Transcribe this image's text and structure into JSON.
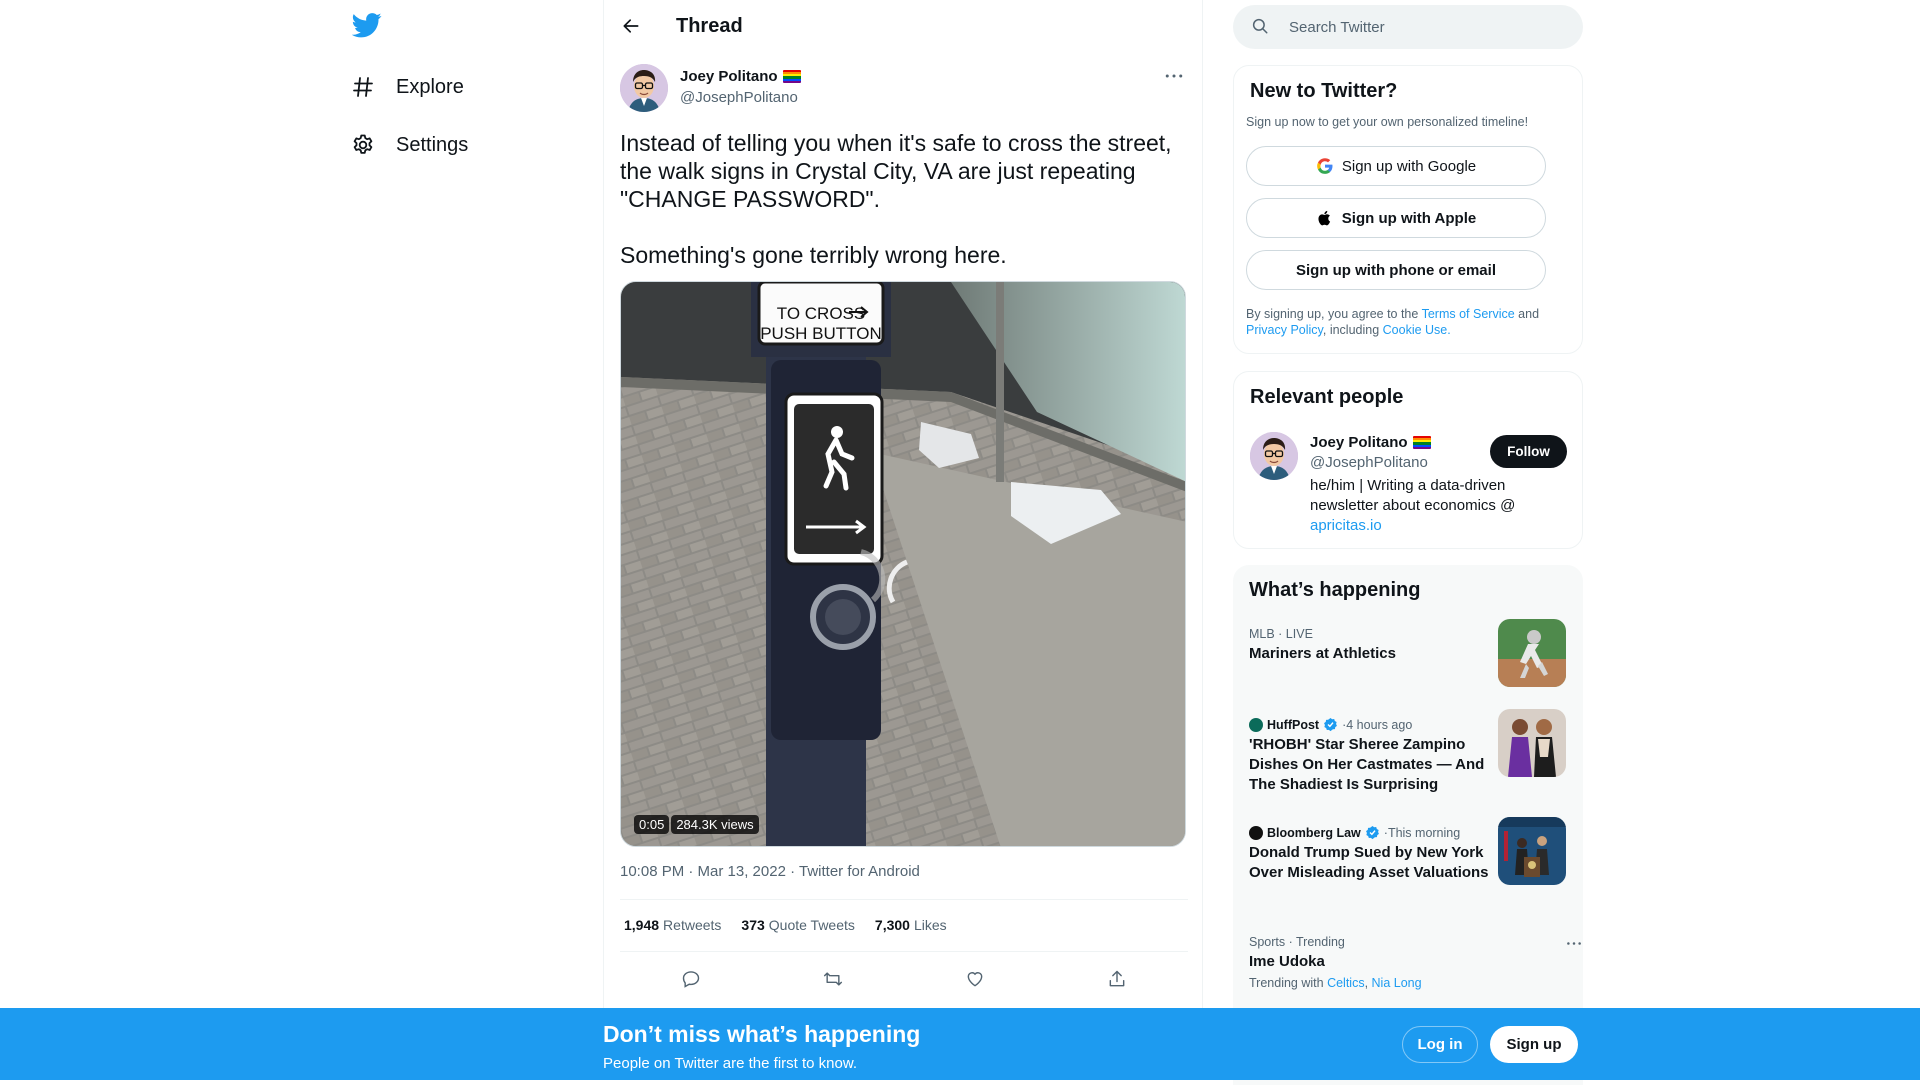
{
  "colors": {
    "brand": "#1d9bf0",
    "text": "#0f1419",
    "muted": "#536471"
  },
  "nav": {
    "items": [
      {
        "icon": "hashtag-icon",
        "label": "Explore"
      },
      {
        "icon": "gear-icon",
        "label": "Settings"
      }
    ]
  },
  "thread": {
    "title": "Thread",
    "author": {
      "name": "Joey Politano",
      "handle": "@JosephPolitano"
    },
    "text": "Instead of telling you when it's safe to cross the street, the walk signs in Crystal City, VA are just repeating \"CHANGE PASSWORD\".\n\nSomething's gone terribly wrong here.",
    "media": {
      "sign_text": "TO CROSS\nPUSH BUTTON",
      "duration": "0:05",
      "views": "284.3K views"
    },
    "meta": "10:08 PM · Mar 13, 2022 · Twitter for Android",
    "stats": [
      {
        "value": "1,948",
        "label": "Retweets"
      },
      {
        "value": "373",
        "label": "Quote Tweets"
      },
      {
        "value": "7,300",
        "label": "Likes"
      }
    ]
  },
  "search": {
    "placeholder": "Search Twitter"
  },
  "new_to_twitter": {
    "title": "New to Twitter?",
    "subtitle": "Sign up now to get your own personalized timeline!",
    "google": "Sign up with Google",
    "apple": "Sign up with Apple",
    "phone": "Sign up with phone or email",
    "legal_pre": "By signing up, you agree to the ",
    "terms": "Terms of Service",
    "and": " and ",
    "privacy": "Privacy Policy",
    "including": ", including ",
    "cookie": "Cookie Use."
  },
  "relevant_people": {
    "title": "Relevant people",
    "name": "Joey Politano",
    "handle": "@JosephPolitano",
    "bio": "he/him | Writing a data-driven newsletter about economics @ ",
    "bio_link": "apricitas.io",
    "follow": "Follow"
  },
  "happening": {
    "title": "What’s happening",
    "trends": [
      {
        "meta": "MLB · LIVE",
        "title": "Mariners at Athletics"
      },
      {
        "source": "HuffPost",
        "time": "4 hours ago",
        "title": "'RHOBH' Star Sheree Zampino Dishes On Her Castmates — And The Shadiest Is Surprising"
      },
      {
        "source": "Bloomberg Law",
        "time": "This morning",
        "title": "Donald Trump Sued by New York Over Misleading Asset Valuations"
      },
      {
        "meta": "Sports · Trending",
        "title": "Ime Udoka",
        "with_label": "Trending with",
        "with_1": "Celtics",
        "with_2": "Nia Long"
      }
    ]
  },
  "bottom_bar": {
    "title": "Don’t miss what’s happening",
    "subtitle": "People on Twitter are the first to know.",
    "login": "Log in",
    "signup": "Sign up"
  }
}
